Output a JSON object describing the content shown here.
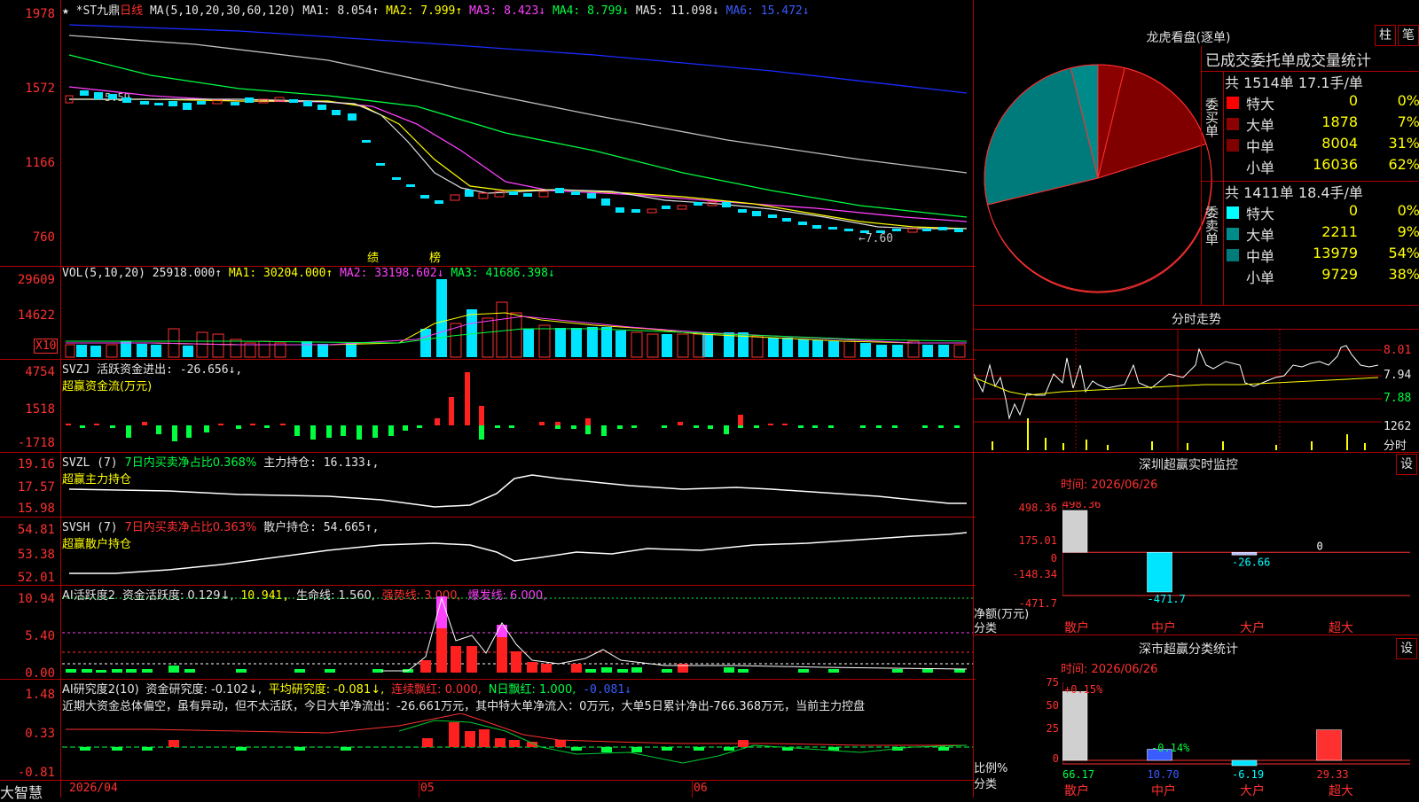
{
  "stock": {
    "name": "*ST九鼎",
    "period": "日线",
    "ma_params": "MA(5,10,20,30,60,120)",
    "ma1": "MA1: 8.054↑",
    "ma2": "MA2: 7.999↑",
    "ma3": "MA3: 8.423↓",
    "ma4": "MA4: 8.799↓",
    "ma5": "MA5: 11.098↓",
    "ma6": "MA6: 15.472↓",
    "price_axis": [
      "1978",
      "1572",
      "1166",
      "760"
    ],
    "label_high": "5.59",
    "label_low": "←7.60",
    "markers": [
      "绩",
      "榜"
    ],
    "star_icon": "★"
  },
  "vol": {
    "title": "VOL(5,10,20)",
    "value": "25918.000↑",
    "ma1": "MA1: 30204.000↑",
    "ma2": "MA2: 33198.602↓",
    "ma3": "MA3: 41686.398↓",
    "axis": [
      "29609",
      "14622"
    ],
    "unit": "X10"
  },
  "svzj": {
    "title": "SVZJ",
    "line": "活跃资金进出: -26.656↓,",
    "subtitle": "超赢资金流(万元)",
    "axis": [
      "4754",
      "1518",
      "-1718"
    ]
  },
  "svzl": {
    "title": "SVZL (7)",
    "pct": "7日内买卖净占比0.368%",
    "line": "主力持仓: 16.133↓,",
    "subtitle": "超赢主力持仓",
    "axis": [
      "19.16",
      "17.57",
      "15.98"
    ]
  },
  "svsh": {
    "title": "SVSH (7)",
    "pct": "7日内买卖净占比0.363%",
    "line": "散户持仓: 54.665↑,",
    "subtitle": "超赢散户持仓",
    "axis": [
      "54.81",
      "53.38",
      "52.01"
    ]
  },
  "ai_active": {
    "title": "AI活跃度2",
    "a": "资金活跃度: 0.129↓,",
    "b": "10.941,",
    "c": "生命线: 1.560,",
    "d": "强势线: 3.000,",
    "e": "爆发线: 6.000,",
    "axis": [
      "10.94",
      "5.40",
      "0.00"
    ]
  },
  "ai_research": {
    "title": "AI研究度2(10)",
    "a": "资金研究度: -0.102↓,",
    "b": "平均研究度: -0.081↓,",
    "c": "连续飘红: 0.000,",
    "d": "N日飘红: 1.000,",
    "e": "-0.081↓",
    "text": "近期大资金总体偏空，虽有异动，但不太活跃，今日大单净流出：-26.661万元，其中特大单净流入：0万元，大单5日累计净出-766.368万元，当前主力控盘",
    "axis": [
      "1.48",
      "0.33",
      "-0.81"
    ]
  },
  "xaxis": [
    "2026/04",
    "05",
    "06"
  ],
  "brand": "大智慧",
  "dragon": {
    "title": "龙虎看盘(逐单)",
    "btn1": "柱",
    "btn2": "笔",
    "header": "已成交委托单成交量统计",
    "buy_label": "委买单",
    "buy_total": "共 1514单 17.1手/单",
    "buy_rows": [
      {
        "name": "特大",
        "count": "0",
        "pct": "0%",
        "color": "#ff0000"
      },
      {
        "name": "大单",
        "count": "1878",
        "pct": "7%",
        "color": "#8b0000"
      },
      {
        "name": "中单",
        "count": "8004",
        "pct": "31%",
        "color": "#800000"
      },
      {
        "name": "小单",
        "count": "16036",
        "pct": "62%",
        "color": "#000000"
      }
    ],
    "sell_label": "委卖单",
    "sell_total": "共 1411单 18.4手/单",
    "sell_rows": [
      {
        "name": "特大",
        "count": "0",
        "pct": "0%",
        "color": "#00ffff"
      },
      {
        "name": "大单",
        "count": "2211",
        "pct": "9%",
        "color": "#008b8b"
      },
      {
        "name": "中单",
        "count": "13979",
        "pct": "54%",
        "color": "#007b7b"
      },
      {
        "name": "小单",
        "count": "9729",
        "pct": "38%",
        "color": "#000000"
      }
    ]
  },
  "intraday": {
    "title": "分时走势",
    "axis": [
      "8.01",
      "7.94",
      "7.88",
      "1262"
    ],
    "unit": "分时"
  },
  "sz_monitor": {
    "title": "深圳超赢实时监控",
    "btn": "设",
    "time": "时间: 2026/06/26",
    "axis": [
      "498.36",
      "175.01",
      "0",
      "-148.34",
      "-471.7"
    ],
    "values": [
      "498.36",
      "-471.7",
      "-26.66",
      "0"
    ],
    "categories": [
      "散户",
      "中户",
      "大户",
      "超大"
    ],
    "ylabel1": "净额(万元)",
    "ylabel2": "分类"
  },
  "sz_class": {
    "title": "深市超赢分类统计",
    "btn": "设",
    "time": "时间: 2026/06/26",
    "axis": [
      "75",
      "50",
      "25",
      "0"
    ],
    "top_labels": [
      "+0.15%",
      "-0.14%"
    ],
    "values": [
      "66.17",
      "10.70",
      "-6.19",
      "29.33"
    ],
    "categories": [
      "散户",
      "中户",
      "大户",
      "超大"
    ],
    "ylabel1": "比例%",
    "ylabel2": "分类"
  },
  "chart_data": [
    {
      "type": "bar",
      "title": "深圳超赢实时监控",
      "categories": [
        "散户",
        "中户",
        "大户",
        "超大"
      ],
      "values": [
        498.36,
        -471.7,
        -26.66,
        0
      ],
      "ylabel": "净额(万元)",
      "xlabel": "分类",
      "ylim": [
        -471.7,
        498.36
      ]
    },
    {
      "type": "bar",
      "title": "深市超赢分类统计",
      "categories": [
        "散户",
        "中户",
        "大户",
        "超大"
      ],
      "values": [
        66.17,
        10.7,
        -6.19,
        29.33
      ],
      "ylabel": "比例%",
      "xlabel": "分类",
      "ylim": [
        0,
        75
      ]
    },
    {
      "type": "pie",
      "title": "龙虎看盘(逐单)",
      "categories": [
        "委买特大",
        "委买大单",
        "委买中单",
        "委买小单",
        "委卖特大",
        "委卖大单",
        "委卖中单",
        "委卖小单"
      ],
      "values": [
        0,
        1878,
        8004,
        16036,
        0,
        2211,
        13979,
        9729
      ]
    }
  ]
}
